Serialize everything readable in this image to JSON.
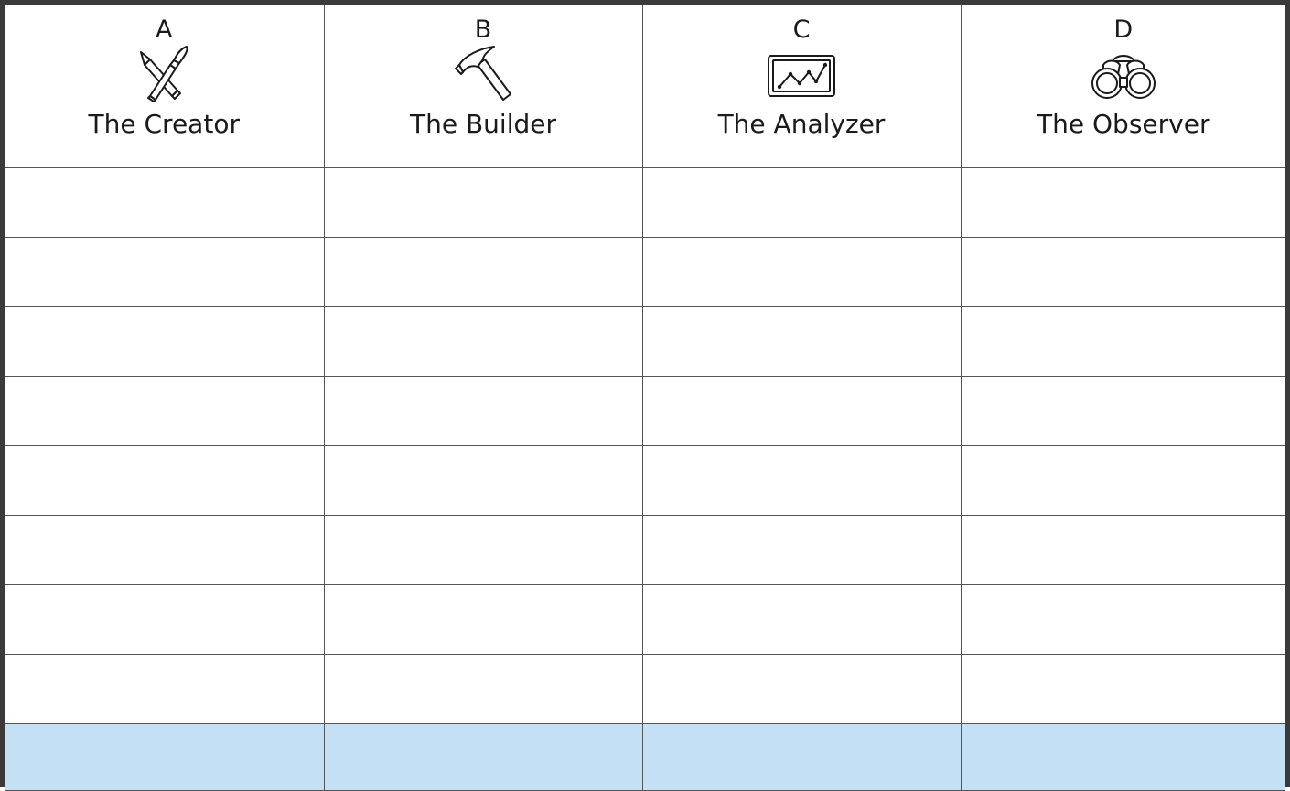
{
  "columns": [
    {
      "letter": "A",
      "role": "The Creator",
      "icon": "pencil-and-brush-icon"
    },
    {
      "letter": "B",
      "role": "The Builder",
      "icon": "hammer-icon"
    },
    {
      "letter": "C",
      "role": "The Analyzer",
      "icon": "line-chart-icon"
    },
    {
      "letter": "D",
      "role": "The Observer",
      "icon": "binoculars-icon"
    }
  ],
  "body_rows": 8,
  "highlight_row_color": "#c3e0f5",
  "border_color": "#555555"
}
